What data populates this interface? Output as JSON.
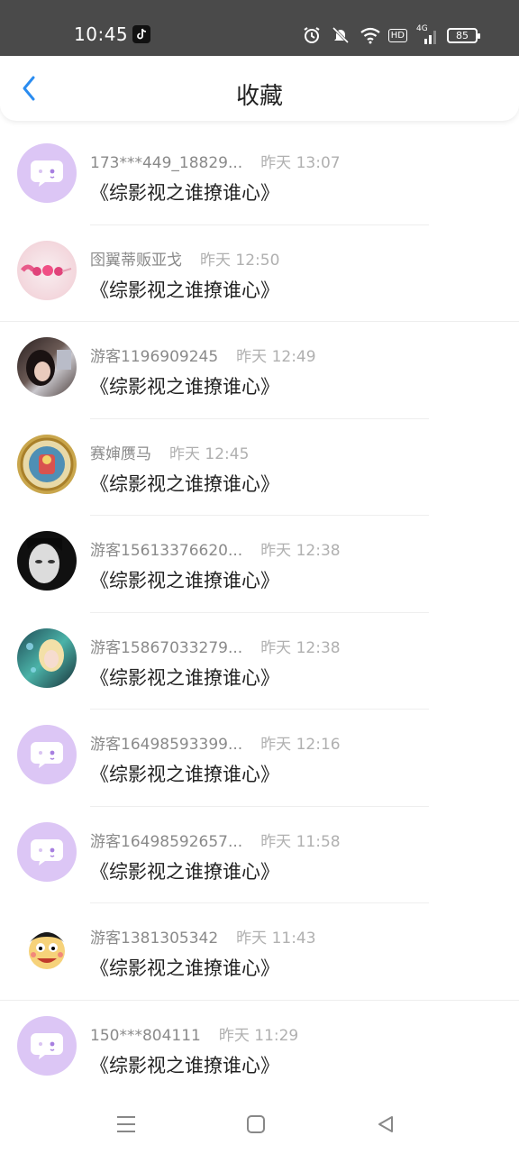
{
  "status_bar": {
    "time": "10:45",
    "battery": "85",
    "network": "4G",
    "hd": "HD",
    "icons": [
      "tiktok-icon",
      "alarm-icon",
      "mute-icon",
      "wifi-icon",
      "hd-icon",
      "signal-icon",
      "battery-icon"
    ]
  },
  "header": {
    "title": "收藏",
    "back_icon": "chevron-left-icon",
    "accent_color": "#2a8cf0"
  },
  "items": [
    {
      "name": "173***449_18829...",
      "time": "昨天 13:07",
      "title": "《综影视之谁撩谁心》",
      "avatar": "chat-bubble-default"
    },
    {
      "name": "囹翼蒂贩亚戈",
      "time": "昨天 12:50",
      "title": "《综影视之谁撩谁心》",
      "avatar": "pink-hearts-photo"
    },
    {
      "name": "游客1196909245",
      "time": "昨天 12:49",
      "title": "《综影视之谁撩谁心》",
      "avatar": "girl-photo"
    },
    {
      "name": "赛婶赝马",
      "time": "昨天 12:45",
      "title": "《综影视之谁撩谁心》",
      "avatar": "medallion-photo"
    },
    {
      "name": "游客15613376620...",
      "time": "昨天 12:38",
      "title": "《综影视之谁撩谁心》",
      "avatar": "bw-face-photo"
    },
    {
      "name": "游客15867033279...",
      "time": "昨天 12:38",
      "title": "《综影视之谁撩谁心》",
      "avatar": "anime-girl-photo"
    },
    {
      "name": "游客16498593399...",
      "time": "昨天 12:16",
      "title": "《综影视之谁撩谁心》",
      "avatar": "chat-bubble-default"
    },
    {
      "name": "游客16498592657...",
      "time": "昨天 11:58",
      "title": "《综影视之谁撩谁心》",
      "avatar": "chat-bubble-default"
    },
    {
      "name": "游客1381305342",
      "time": "昨天 11:43",
      "title": "《综影视之谁撩谁心》",
      "avatar": "cartoon-boy-photo"
    },
    {
      "name": "150***804111",
      "time": "昨天 11:29",
      "title": "《综影视之谁撩谁心》",
      "avatar": "chat-bubble-default"
    }
  ],
  "nav_bar": {
    "icons": [
      "menu-icon",
      "home-square-icon",
      "back-triangle-icon"
    ]
  },
  "colors": {
    "default_avatar": "#dcc6f5",
    "status_bar_bg": "#4a4a4a"
  }
}
